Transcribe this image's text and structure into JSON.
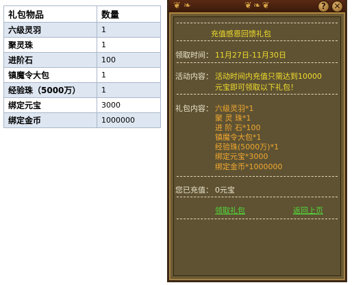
{
  "table": {
    "header_item": "礼包物品",
    "header_qty": "数量",
    "rows": [
      {
        "item": "六级灵羽",
        "qty": "1"
      },
      {
        "item": "聚灵珠",
        "qty": "1"
      },
      {
        "item": "进阶石",
        "qty": "100"
      },
      {
        "item": "镇魔令大包",
        "qty": "1"
      },
      {
        "item": "经验珠（5000万）",
        "qty": "1"
      },
      {
        "item": "绑定元宝",
        "qty": "3000"
      },
      {
        "item": "绑定金币",
        "qty": "1000000"
      }
    ]
  },
  "panel": {
    "title": "充值感恩回馈礼包",
    "time_label": "领取时间：",
    "time_value": "11月27日-11月30日",
    "activity_label": "活动内容：",
    "activity_line1": "活动时间内充值只需达到10000",
    "activity_line2": "元宝即可领取以下礼包！",
    "gift_label": "礼包内容：",
    "gift_items": [
      "六级灵羽*1",
      "聚 灵 珠*1",
      "进 阶 石*100",
      "镇魔令大包*1",
      "经验珠(5000万)*1",
      "绑定元宝*3000",
      "绑定金币*1000000"
    ],
    "recharged_label": "您已充值：",
    "recharged_value": "0元宝",
    "claim_link": "领取礼包",
    "back_link": "返回上页",
    "help_symbol": "?",
    "close_symbol": "✕"
  },
  "colors": {
    "panel_bg": "#5e5232",
    "title_yellow": "#f2dd2c",
    "item_orange": "#f2a830",
    "link_green": "#52d83a"
  }
}
